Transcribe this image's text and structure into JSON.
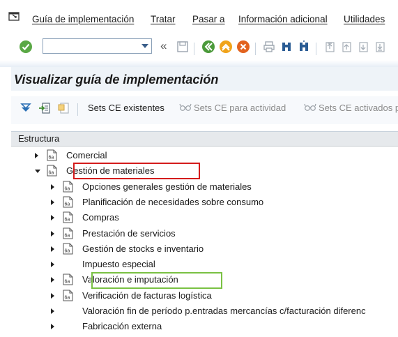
{
  "menubar": {
    "items": [
      {
        "label": "Guía de implementación"
      },
      {
        "label": "Tratar"
      },
      {
        "label": "Pasar a"
      },
      {
        "label": "Información adicional"
      },
      {
        "label": "Utilidades"
      }
    ]
  },
  "toolbar": {
    "command_value": "",
    "icons": [
      "enter-icon",
      "history-back-icon",
      "save-icon",
      "back-icon",
      "exit-icon",
      "cancel-icon",
      "print-icon",
      "find-icon",
      "find-next-icon",
      "first-page-icon",
      "previous-page-icon",
      "next-page-icon",
      "last-page-icon"
    ]
  },
  "page": {
    "title": "Visualizar guía de implementación"
  },
  "app_toolbar": {
    "sets_ce_existentes": "Sets CE existentes",
    "sets_ce_para_actividad": "Sets CE para actividad",
    "sets_ce_activados": "Sets CE activados p"
  },
  "tree": {
    "header": "Estructura",
    "rows": [
      {
        "label": "Comercial",
        "level": 1,
        "expanded": false,
        "icon": true
      },
      {
        "label": "Gestión de materiales",
        "level": 1,
        "expanded": true,
        "icon": true
      },
      {
        "label": "Opciones generales gestión de materiales",
        "level": 2,
        "expanded": false,
        "icon": true
      },
      {
        "label": "Planificación de necesidades sobre consumo",
        "level": 2,
        "expanded": false,
        "icon": true
      },
      {
        "label": "Compras",
        "level": 2,
        "expanded": false,
        "icon": true
      },
      {
        "label": "Prestación de servicios",
        "level": 2,
        "expanded": false,
        "icon": true
      },
      {
        "label": "Gestión de stocks e inventario",
        "level": 2,
        "expanded": false,
        "icon": true
      },
      {
        "label": "Impuesto especial",
        "level": 2,
        "expanded": false,
        "icon": false
      },
      {
        "label": "Valoración e imputación",
        "level": 2,
        "expanded": false,
        "icon": true
      },
      {
        "label": "Verificación de facturas logística",
        "level": 2,
        "expanded": false,
        "icon": true
      },
      {
        "label": "Valoración fin de período p.entradas mercancías c/facturación diferenc",
        "level": 2,
        "expanded": false,
        "icon": false
      },
      {
        "label": "Fabricación externa",
        "level": 2,
        "expanded": false,
        "icon": false
      }
    ]
  },
  "colors": {
    "highlight_red": "#d41c1c",
    "highlight_green": "#7ac143",
    "sap_blue": "#2a6fb5"
  }
}
